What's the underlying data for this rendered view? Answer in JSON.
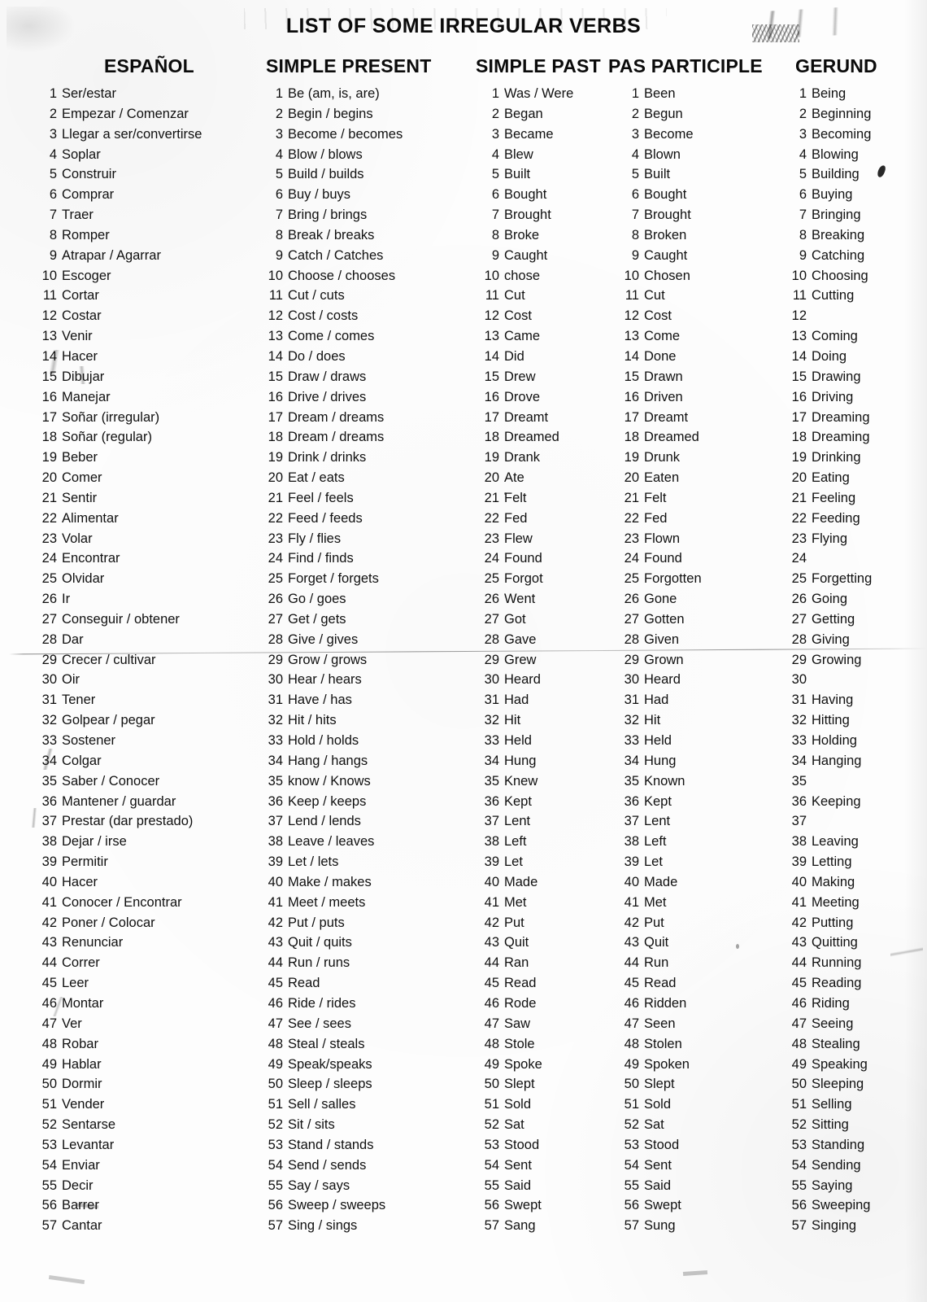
{
  "document": {
    "title": "LIST OF SOME IRREGULAR VERBS"
  },
  "table": {
    "headers": {
      "espanol": "ESPAÑOL",
      "simple_present": "SIMPLE PRESENT",
      "simple_past": "SIMPLE PAST",
      "past_participle": "PAS PARTICIPLE",
      "gerund": "GERUND"
    },
    "rows": [
      {
        "n": 1,
        "espanol": "Ser/estar",
        "simple_present": "Be (am, is, are)",
        "simple_past": "Was / Were",
        "past_participle": "Been",
        "gerund": "Being"
      },
      {
        "n": 2,
        "espanol": "Empezar / Comenzar",
        "simple_present": "Begin / begins",
        "simple_past": "Began",
        "past_participle": "Begun",
        "gerund": "Beginning"
      },
      {
        "n": 3,
        "espanol": "Llegar a ser/convertirse",
        "simple_present": "Become / becomes",
        "simple_past": "Became",
        "past_participle": "Become",
        "gerund": "Becoming"
      },
      {
        "n": 4,
        "espanol": "Soplar",
        "simple_present": "Blow / blows",
        "simple_past": "Blew",
        "past_participle": "Blown",
        "gerund": "Blowing"
      },
      {
        "n": 5,
        "espanol": "Construir",
        "simple_present": "Build / builds",
        "simple_past": "Built",
        "past_participle": "Built",
        "gerund": "Building"
      },
      {
        "n": 6,
        "espanol": "Comprar",
        "simple_present": "Buy / buys",
        "simple_past": "Bought",
        "past_participle": "Bought",
        "gerund": "Buying"
      },
      {
        "n": 7,
        "espanol": "Traer",
        "simple_present": "Bring / brings",
        "simple_past": "Brought",
        "past_participle": "Brought",
        "gerund": "Bringing"
      },
      {
        "n": 8,
        "espanol": "Romper",
        "simple_present": "Break / breaks",
        "simple_past": "Broke",
        "past_participle": "Broken",
        "gerund": "Breaking"
      },
      {
        "n": 9,
        "espanol": "Atrapar / Agarrar",
        "simple_present": "Catch / Catches",
        "simple_past": "Caught",
        "past_participle": "Caught",
        "gerund": "Catching"
      },
      {
        "n": 10,
        "espanol": "Escoger",
        "simple_present": "Choose / chooses",
        "simple_past": "chose",
        "past_participle": "Chosen",
        "gerund": "Choosing"
      },
      {
        "n": 11,
        "espanol": "Cortar",
        "simple_present": "Cut / cuts",
        "simple_past": "Cut",
        "past_participle": "Cut",
        "gerund": "Cutting"
      },
      {
        "n": 12,
        "espanol": "Costar",
        "simple_present": "Cost / costs",
        "simple_past": "Cost",
        "past_participle": "Cost",
        "gerund": ""
      },
      {
        "n": 13,
        "espanol": "Venir",
        "simple_present": "Come / comes",
        "simple_past": "Came",
        "past_participle": "Come",
        "gerund": "Coming"
      },
      {
        "n": 14,
        "espanol": "Hacer",
        "simple_present": "Do / does",
        "simple_past": "Did",
        "past_participle": "Done",
        "gerund": "Doing"
      },
      {
        "n": 15,
        "espanol": "Dibujar",
        "simple_present": "Draw / draws",
        "simple_past": "Drew",
        "past_participle": "Drawn",
        "gerund": "Drawing"
      },
      {
        "n": 16,
        "espanol": "Manejar",
        "simple_present": "Drive / drives",
        "simple_past": "Drove",
        "past_participle": "Driven",
        "gerund": "Driving"
      },
      {
        "n": 17,
        "espanol": "Soñar (irregular)",
        "simple_present": "Dream / dreams",
        "simple_past": "Dreamt",
        "past_participle": "Dreamt",
        "gerund": "Dreaming"
      },
      {
        "n": 18,
        "espanol": "Soñar (regular)",
        "simple_present": "Dream / dreams",
        "simple_past": "Dreamed",
        "past_participle": "Dreamed",
        "gerund": "Dreaming"
      },
      {
        "n": 19,
        "espanol": "Beber",
        "simple_present": "Drink / drinks",
        "simple_past": "Drank",
        "past_participle": "Drunk",
        "gerund": "Drinking"
      },
      {
        "n": 20,
        "espanol": "Comer",
        "simple_present": "Eat / eats",
        "simple_past": "Ate",
        "past_participle": "Eaten",
        "gerund": "Eating"
      },
      {
        "n": 21,
        "espanol": "Sentir",
        "simple_present": "Feel / feels",
        "simple_past": "Felt",
        "past_participle": "Felt",
        "gerund": "Feeling"
      },
      {
        "n": 22,
        "espanol": "Alimentar",
        "simple_present": "Feed / feeds",
        "simple_past": "Fed",
        "past_participle": "Fed",
        "gerund": "Feeding"
      },
      {
        "n": 23,
        "espanol": "Volar",
        "simple_present": "Fly / flies",
        "simple_past": "Flew",
        "past_participle": "Flown",
        "gerund": "Flying"
      },
      {
        "n": 24,
        "espanol": "Encontrar",
        "simple_present": "Find / finds",
        "simple_past": "Found",
        "past_participle": "Found",
        "gerund": ""
      },
      {
        "n": 25,
        "espanol": "Olvidar",
        "simple_present": "Forget / forgets",
        "simple_past": "Forgot",
        "past_participle": "Forgotten",
        "gerund": "Forgetting"
      },
      {
        "n": 26,
        "espanol": "Ir",
        "simple_present": "Go / goes",
        "simple_past": "Went",
        "past_participle": "Gone",
        "gerund": "Going"
      },
      {
        "n": 27,
        "espanol": "Conseguir / obtener",
        "simple_present": "Get / gets",
        "simple_past": "Got",
        "past_participle": "Gotten",
        "gerund": "Getting"
      },
      {
        "n": 28,
        "espanol": "Dar",
        "simple_present": "Give / gives",
        "simple_past": "Gave",
        "past_participle": "Given",
        "gerund": "Giving"
      },
      {
        "n": 29,
        "espanol": "Crecer / cultivar",
        "simple_present": "Grow / grows",
        "simple_past": "Grew",
        "past_participle": "Grown",
        "gerund": "Growing"
      },
      {
        "n": 30,
        "espanol": "Oir",
        "simple_present": "Hear / hears",
        "simple_past": "Heard",
        "past_participle": "Heard",
        "gerund": ""
      },
      {
        "n": 31,
        "espanol": "Tener",
        "simple_present": "Have / has",
        "simple_past": "Had",
        "past_participle": "Had",
        "gerund": "Having"
      },
      {
        "n": 32,
        "espanol": "Golpear / pegar",
        "simple_present": "Hit / hits",
        "simple_past": "Hit",
        "past_participle": "Hit",
        "gerund": "Hitting"
      },
      {
        "n": 33,
        "espanol": "Sostener",
        "simple_present": "Hold / holds",
        "simple_past": "Held",
        "past_participle": "Held",
        "gerund": "Holding"
      },
      {
        "n": 34,
        "espanol": "Colgar",
        "simple_present": "Hang / hangs",
        "simple_past": "Hung",
        "past_participle": "Hung",
        "gerund": "Hanging"
      },
      {
        "n": 35,
        "espanol": "Saber / Conocer",
        "simple_present": "know / Knows",
        "simple_past": "Knew",
        "past_participle": "Known",
        "gerund": ""
      },
      {
        "n": 36,
        "espanol": "Mantener / guardar",
        "simple_present": "Keep / keeps",
        "simple_past": "Kept",
        "past_participle": "Kept",
        "gerund": "Keeping"
      },
      {
        "n": 37,
        "espanol": "Prestar (dar prestado)",
        "simple_present": "Lend / lends",
        "simple_past": "Lent",
        "past_participle": "Lent",
        "gerund": ""
      },
      {
        "n": 38,
        "espanol": "Dejar / irse",
        "simple_present": "Leave / leaves",
        "simple_past": "Left",
        "past_participle": "Left",
        "gerund": "Leaving"
      },
      {
        "n": 39,
        "espanol": "Permitir",
        "simple_present": "Let / lets",
        "simple_past": "Let",
        "past_participle": "Let",
        "gerund": "Letting"
      },
      {
        "n": 40,
        "espanol": "Hacer",
        "simple_present": "Make / makes",
        "simple_past": "Made",
        "past_participle": "Made",
        "gerund": "Making"
      },
      {
        "n": 41,
        "espanol": "Conocer / Encontrar",
        "simple_present": "Meet / meets",
        "simple_past": "Met",
        "past_participle": "Met",
        "gerund": "Meeting"
      },
      {
        "n": 42,
        "espanol": "Poner / Colocar",
        "simple_present": "Put / puts",
        "simple_past": "Put",
        "past_participle": "Put",
        "gerund": "Putting"
      },
      {
        "n": 43,
        "espanol": "Renunciar",
        "simple_present": "Quit / quits",
        "simple_past": "Quit",
        "past_participle": "Quit",
        "gerund": "Quitting"
      },
      {
        "n": 44,
        "espanol": "Correr",
        "simple_present": "Run / runs",
        "simple_past": "Ran",
        "past_participle": "Run",
        "gerund": "Running"
      },
      {
        "n": 45,
        "espanol": "Leer",
        "simple_present": "Read",
        "simple_past": "Read",
        "past_participle": "Read",
        "gerund": "Reading"
      },
      {
        "n": 46,
        "espanol": "Montar",
        "simple_present": "Ride / rides",
        "simple_past": "Rode",
        "past_participle": "Ridden",
        "gerund": "Riding"
      },
      {
        "n": 47,
        "espanol": "Ver",
        "simple_present": "See / sees",
        "simple_past": "Saw",
        "past_participle": "Seen",
        "gerund": "Seeing"
      },
      {
        "n": 48,
        "espanol": "Robar",
        "simple_present": "Steal / steals",
        "simple_past": "Stole",
        "past_participle": "Stolen",
        "gerund": "Stealing"
      },
      {
        "n": 49,
        "espanol": "Hablar",
        "simple_present": "Speak/speaks",
        "simple_past": "Spoke",
        "past_participle": "Spoken",
        "gerund": "Speaking"
      },
      {
        "n": 50,
        "espanol": "Dormir",
        "simple_present": "Sleep / sleeps",
        "simple_past": "Slept",
        "past_participle": "Slept",
        "gerund": "Sleeping"
      },
      {
        "n": 51,
        "espanol": "Vender",
        "simple_present": "Sell / salles",
        "simple_past": "Sold",
        "past_participle": "Sold",
        "gerund": "Selling"
      },
      {
        "n": 52,
        "espanol": "Sentarse",
        "simple_present": "Sit / sits",
        "simple_past": "Sat",
        "past_participle": "Sat",
        "gerund": "Sitting"
      },
      {
        "n": 53,
        "espanol": "Levantar",
        "simple_present": "Stand / stands",
        "simple_past": "Stood",
        "past_participle": "Stood",
        "gerund": "Standing"
      },
      {
        "n": 54,
        "espanol": "Enviar",
        "simple_present": "Send / sends",
        "simple_past": "Sent",
        "past_participle": "Sent",
        "gerund": "Sending"
      },
      {
        "n": 55,
        "espanol": "Decir",
        "simple_present": "Say / says",
        "simple_past": "Said",
        "past_participle": "Said",
        "gerund": "Saying"
      },
      {
        "n": 56,
        "espanol": "Barrer",
        "simple_present": "Sweep / sweeps",
        "simple_past": "Swept",
        "past_participle": "Swept",
        "gerund": "Sweeping"
      },
      {
        "n": 57,
        "espanol": "Cantar",
        "simple_present": "Sing / sings",
        "simple_past": "Sang",
        "past_participle": "Sung",
        "gerund": "Singing"
      }
    ]
  }
}
